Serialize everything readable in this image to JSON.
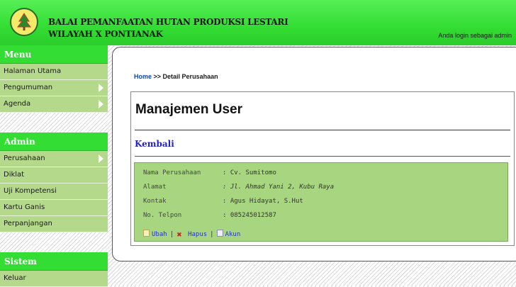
{
  "header": {
    "title_line1": "BALAI PEMANFAATAN HUTAN PRODUKSI LESTARI",
    "title_line2": "WILAYAH X PONTIANAK",
    "login_text": "Anda login sebagai admin"
  },
  "sidebar": {
    "menu_title": "Menu",
    "menu_items": [
      "Halaman Utama",
      "Pengumuman",
      "Agenda"
    ],
    "admin_title": "Admin",
    "admin_items": [
      "Perusahaan",
      "Diklat",
      "Uji Kompetensi",
      "Kartu Ganis",
      "Perpanjangan"
    ],
    "system_title": "Sistem",
    "system_items": [
      "Keluar"
    ]
  },
  "breadcrumb": {
    "home": "Home",
    "rest": ">> Detail Perusahaan"
  },
  "page": {
    "title": "Manajemen User",
    "back": "Kembali"
  },
  "detail": {
    "rows": [
      {
        "label": "Nama Perusahaan",
        "value": ": Cv. Sumitomo"
      },
      {
        "label": "Alamat",
        "value": ": Jl. Ahmad Yani 2, Kubu Raya"
      },
      {
        "label": "Kontak",
        "value": ": Agus Hidayat, S.Hut"
      },
      {
        "label": "No. Telpon",
        "value": ": 085245012587"
      }
    ],
    "actions": {
      "edit": "Ubah",
      "delete": "Hapus",
      "account": "Akun",
      "separator": "|"
    }
  },
  "colors": {
    "header_green": "#33dd33",
    "menu_bg": "#b4d98a",
    "detail_bg": "#a8d580",
    "link_blue": "#2233cc"
  },
  "icons": [
    "tree-logo-icon",
    "arrow-right-icon",
    "edit-doc-icon",
    "delete-x-icon",
    "user-account-icon"
  ]
}
